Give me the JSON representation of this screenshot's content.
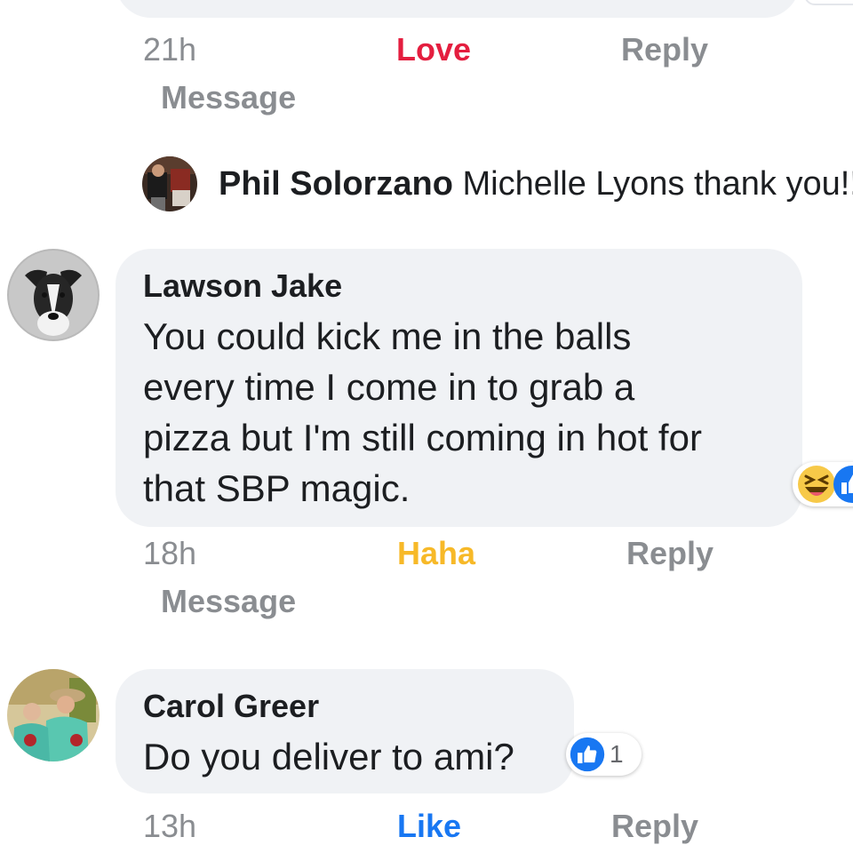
{
  "top_comment": {
    "time": "21h",
    "reaction_label": "Love",
    "reply_label": "Reply",
    "message_label": "Message"
  },
  "phil_reply": {
    "author": "Phil Solorzano",
    "text": "Michelle Lyons thank you!!"
  },
  "lawson_comment": {
    "author": "Lawson Jake",
    "lines": [
      "You could kick me in the balls",
      "every time I come in to grab a",
      "pizza but I'm still coming in hot for",
      "that SBP magic."
    ],
    "time": "18h",
    "reaction_label": "Haha",
    "reply_label": "Reply",
    "message_label": "Message",
    "reaction_icons": [
      "haha-emoji-icon",
      "like-emoji-icon"
    ]
  },
  "carol_comment": {
    "author": "Carol Greer",
    "text": "Do you deliver to ami?",
    "reaction_icon": "like-emoji-icon",
    "reaction_count": "1",
    "time": "13h",
    "reaction_label": "Like",
    "reply_label": "Reply"
  },
  "colors": {
    "bubble": "#f0f2f5",
    "meta": "#8a8d91",
    "love": "#e41e3f",
    "haha": "#f7b928",
    "like": "#1877f2",
    "text": "#1c1e21"
  }
}
